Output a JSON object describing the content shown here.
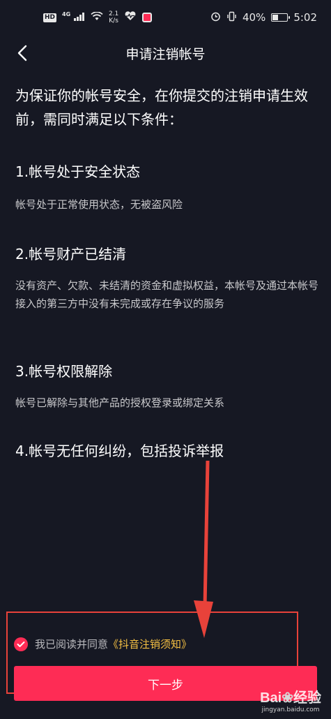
{
  "status_bar": {
    "hd": "HD",
    "network": "4G",
    "speed_value": "2.1",
    "speed_unit": "K/s",
    "battery": "40%",
    "time": "5:02"
  },
  "header": {
    "title": "申请注销帐号"
  },
  "content": {
    "intro": "为保证你的帐号安全，在你提交的注销申请生效前，需同时满足以下条件：",
    "conditions": [
      {
        "title": "1.帐号处于安全状态",
        "desc": "帐号处于正常使用状态，无被盗风险"
      },
      {
        "title": "2.帐号财产已结清",
        "desc": "没有资产、欠款、未结清的资金和虚拟权益，本帐号及通过本帐号接入的第三方中没有未完成或存在争议的服务"
      },
      {
        "title": "3.帐号权限解除",
        "desc": "帐号已解除与其他产品的授权登录或绑定关系"
      },
      {
        "title": "4.帐号无任何纠纷，包括投诉举报",
        "desc": ""
      }
    ]
  },
  "agreement": {
    "text": "我已阅读并同意",
    "link": "《抖音注销须知》",
    "checked": true
  },
  "next_button": {
    "label": "下一步"
  },
  "watermark": {
    "logo": "Bai度经验",
    "url": "jingyan.baidu.com"
  },
  "colors": {
    "background": "#161823",
    "accent": "#fe2c55",
    "link": "#f5c043",
    "annotation": "#e8423a"
  }
}
